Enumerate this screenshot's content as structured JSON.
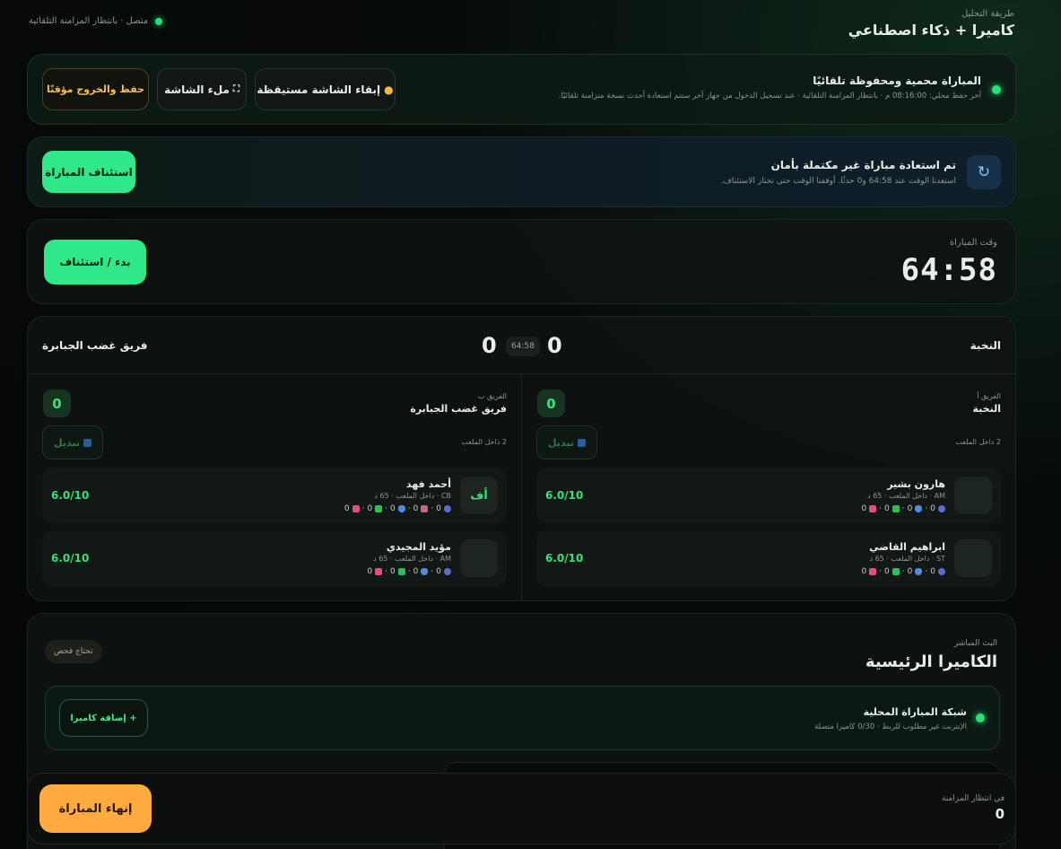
{
  "status": {
    "text": "متصل · بانتظار المزامنة التلقائية"
  },
  "header": {
    "mode_label": "طريقة التحليل",
    "mode_value": "كاميرا + ذكاء اصطناعي"
  },
  "autosave": {
    "title": "المباراة محمية ومحفوظة تلقائيًا",
    "desc": "آخر حفظ محلي: 08:16:00 م · بانتظار المزامنة التلقائية · عند تسجيل الدخول من جهاز آخر ستتم استعادة أحدث نسخة متزامنة تلقائيًا.",
    "keep_awake": "إبقاء الشاشة مستيقظة",
    "fullscreen": "ملء الشاشة",
    "save_exit": "حفظ والخروج مؤقتًا"
  },
  "restore": {
    "title": "تم استعادة مباراة غير مكتملة بأمان",
    "desc": "استعدنا الوقت عند 64:58 و0 حدثًا. أوقفنا الوقت حتى تختار الاستئناف.",
    "resume": "استئناف المباراة"
  },
  "timer": {
    "label": "وقت المباراة",
    "value": "64:58",
    "button": "بدء / استئناف"
  },
  "scoreboard": {
    "team_a": "النخبة",
    "team_b": "فريق غضب الجبابرة",
    "score_a": "0",
    "score_b": "0",
    "time": "64:58"
  },
  "team_a": {
    "tag": "الفريق أ",
    "name": "النخبة",
    "score": "0",
    "on_field": "2 داخل الملعب",
    "sub": "تبديل",
    "players": [
      {
        "name": "هارون بشير",
        "meta": "AM · داخل الملعب · 65 د",
        "rating": "6.0/10",
        "avatar": "",
        "s1": "0",
        "s2": "0",
        "s3": "0",
        "s4": "0"
      },
      {
        "name": "ابراهيم القاضي",
        "meta": "ST · داخل الملعب · 65 د",
        "rating": "6.0/10",
        "avatar": "",
        "s1": "0",
        "s2": "0",
        "s3": "0",
        "s4": "0"
      }
    ]
  },
  "team_b": {
    "tag": "الفريق ب",
    "name": "فريق غضب الجبابرة",
    "score": "0",
    "on_field": "2 داخل الملعب",
    "sub": "تبديل",
    "players": [
      {
        "name": "أحمد فهد",
        "meta": "CB · داخل الملعب · 65 د",
        "rating": "6.0/10",
        "avatar": "أف",
        "s1": "0",
        "s2": "0",
        "s3": "0",
        "s4": "0",
        "s5": "0"
      },
      {
        "name": "مؤيد المجيدي",
        "meta": "AM · داخل الملعب · 65 د",
        "rating": "6.0/10",
        "avatar": "",
        "s1": "0",
        "s2": "0",
        "s3": "0",
        "s4": "0"
      }
    ]
  },
  "live": {
    "label": "البث المباشر",
    "title": "الكاميرا الرئيسية",
    "badge": "تحتاج فحص",
    "network_title": "شبكة المباراة المحلية",
    "network_desc": "الإنترنت غير مطلوب للربط · 0/30 كاميرا متصلة",
    "add_camera": "+ إضافة كاميرا"
  },
  "footer": {
    "pending_label": "في انتظار المزامنة",
    "pending_value": "0",
    "end_match": "إنهاء المباراة"
  },
  "colors": {
    "accent": "#2ee88a",
    "warning": "#ffaa40"
  }
}
